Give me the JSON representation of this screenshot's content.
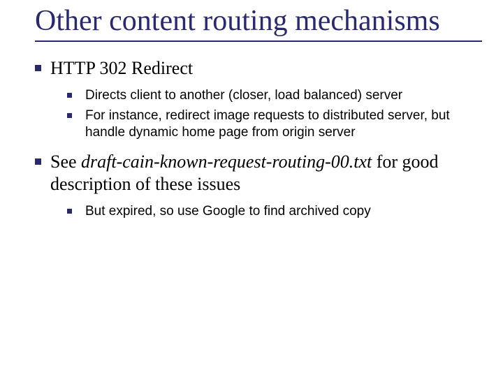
{
  "slide": {
    "title": "Other content routing mechanisms",
    "bullets": [
      {
        "text": "HTTP 302 Redirect",
        "sub": [
          "Directs client to another (closer, load balanced) server",
          "For instance, redirect image requests to distributed server, but handle dynamic home page from origin server"
        ]
      },
      {
        "prefix": "See ",
        "italic": "draft-cain-known-request-routing-00.txt",
        "suffix": " for good description of these issues",
        "sub": [
          "But expired, so use Google to find archived copy"
        ]
      }
    ]
  }
}
